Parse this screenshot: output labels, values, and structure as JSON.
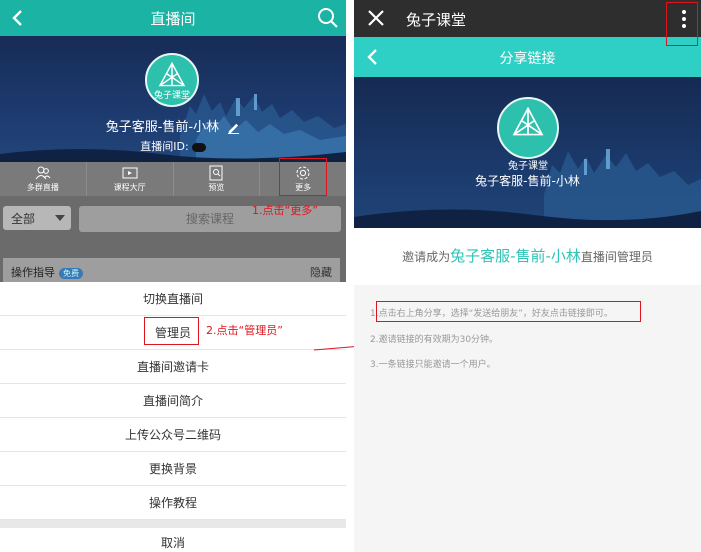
{
  "left": {
    "header_title": "直播间",
    "streamer_name": "兔子客服-售前-小林",
    "logo_text": "兔子课堂",
    "room_id_label": "直播间ID:",
    "tabs": [
      "多群直播",
      "课程大厅",
      "预览",
      "更多"
    ],
    "filter_value": "全部",
    "search_placeholder": "搜索课程",
    "guide_label": "操作指导",
    "guide_badge": "免费",
    "guide_hide": "隐藏",
    "menu_items": [
      "切换直播间",
      "管理员",
      "直播间邀请卡",
      "直播间简介",
      "上传公众号二维码",
      "更换背景",
      "操作教程"
    ],
    "cancel": "取消"
  },
  "annotations": {
    "step1": "1.点击“更多”",
    "step2": "2.点击“管理员”"
  },
  "right": {
    "top_title": "兔子课堂",
    "header_title": "分享链接",
    "logo_text": "兔子课堂",
    "streamer_name": "兔子客服-售前-小林",
    "invite_prefix": "邀请成为",
    "invite_name": "兔子客服-售前-小林",
    "invite_suffix": "直播间管理员",
    "notes": [
      "1.点击右上角分享，选择“发送给朋友”，好友点击链接即可。",
      "2.邀请链接的有效期为30分钟。",
      "3.一条链接只能邀请一个用户。"
    ]
  },
  "colors": {
    "left_header": "#1bb3a3",
    "right_header": "#2ecfc5",
    "highlight": "#2ec4b6",
    "annotation": "#e0141e"
  }
}
